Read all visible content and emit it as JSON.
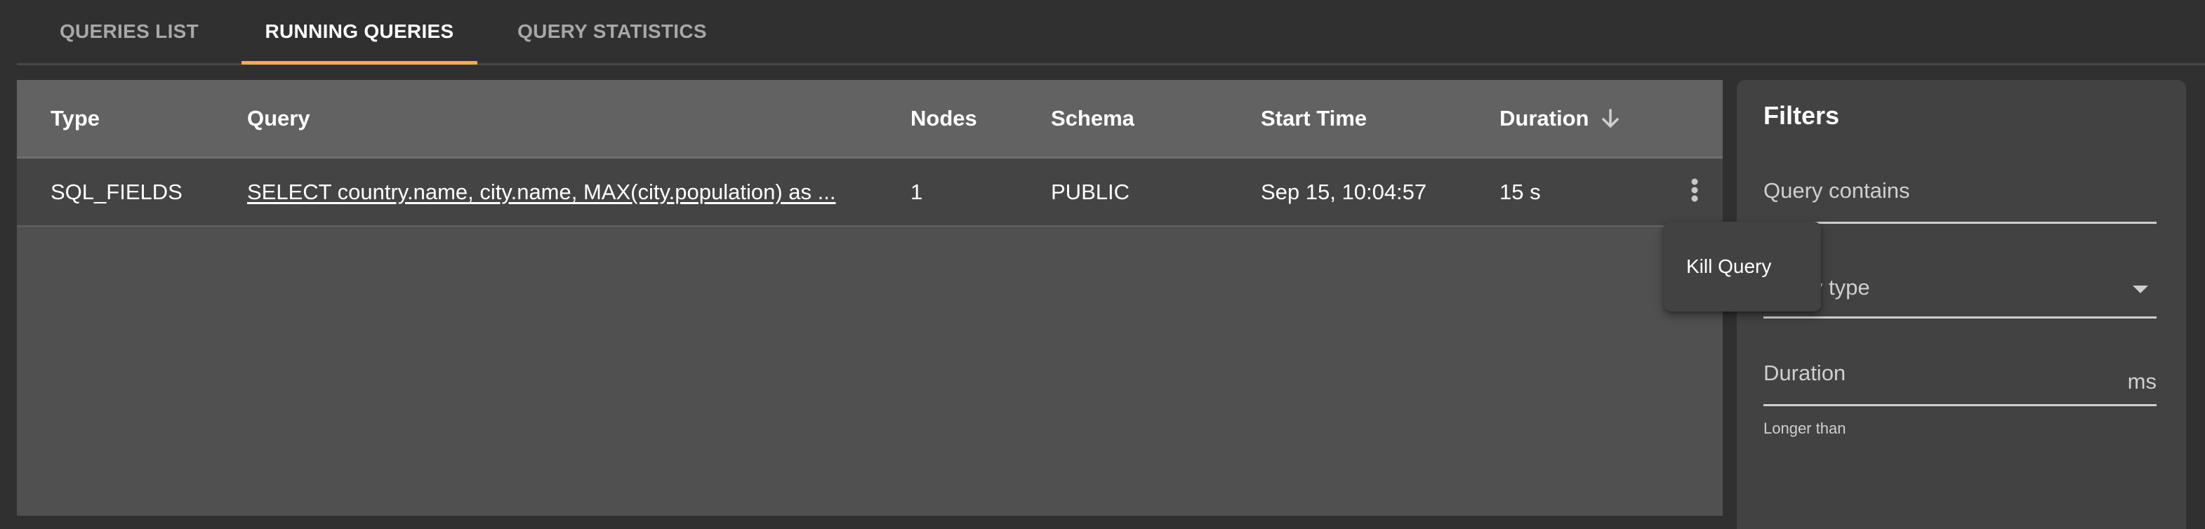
{
  "tabs": [
    {
      "label": "QUERIES LIST",
      "active": false
    },
    {
      "label": "RUNNING QUERIES",
      "active": true
    },
    {
      "label": "QUERY STATISTICS",
      "active": false
    }
  ],
  "colors": {
    "accent": "#f9ae45",
    "background": "#303030",
    "table_header": "#626262",
    "table_row": "#444444",
    "table_body": "#505050",
    "panel": "#424242"
  },
  "table": {
    "columns": [
      "Type",
      "Query",
      "Nodes",
      "Schema",
      "Start Time",
      "Duration"
    ],
    "sort": {
      "column": "Duration",
      "direction": "descending",
      "icon": "arrow-down-icon"
    },
    "rows": [
      {
        "type": "SQL_FIELDS",
        "query": "SELECT country.name, city.name, MAX(city.population) as ...",
        "nodes": "1",
        "schema": "PUBLIC",
        "start_time": "Sep 15, 10:04:57",
        "duration": "15 s",
        "actions_icon": "more-vert-icon"
      }
    ]
  },
  "context_menu": {
    "items": [
      "Kill Query"
    ]
  },
  "filters": {
    "title": "Filters",
    "query_contains": {
      "label": "Query contains",
      "value": ""
    },
    "query_type": {
      "label": "Query type",
      "value": "",
      "icon": "dropdown-arrow-icon"
    },
    "duration": {
      "label": "Duration",
      "suffix": "ms",
      "hint": "Longer than",
      "value": ""
    }
  }
}
